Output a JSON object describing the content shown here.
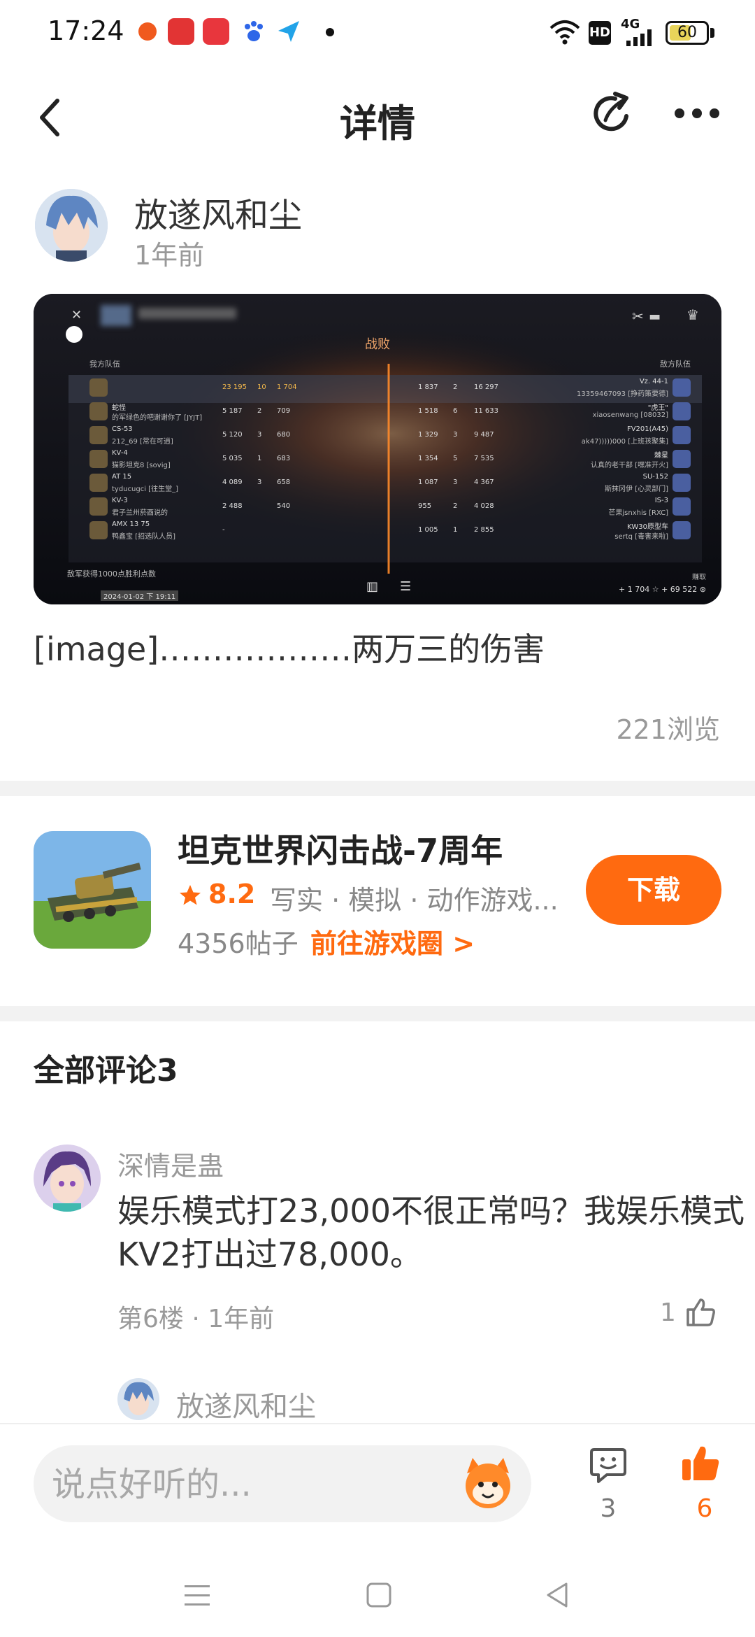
{
  "status_bar": {
    "time": "17:24",
    "network": "4G",
    "battery": "60",
    "battery_level_percent": 60
  },
  "header": {
    "title": "详情"
  },
  "post": {
    "author": "放遂风和尘",
    "time": "1年前",
    "text": "[image]………………两万三的伤害",
    "views": "221浏览"
  },
  "screenshot_overlay": {
    "center_title": "战败",
    "left_team_label": "我方队伍",
    "right_team_label": "敌方队伍",
    "left_rows": [
      {
        "name": "",
        "sub": "",
        "dmg": "23 195",
        "kills": "10",
        "xp": "1 704"
      },
      {
        "name": "蛇怪",
        "sub": "的军绿色的吧谢谢你了 [JYJT]",
        "dmg": "5 187",
        "kills": "2",
        "xp": "709"
      },
      {
        "name": "CS-53",
        "sub": "212_69 [常在可逍]",
        "dmg": "5 120",
        "kills": "3",
        "xp": "680"
      },
      {
        "name": "KV-4",
        "sub": "猫影坦克8 [sovig]",
        "dmg": "5 035",
        "kills": "1",
        "xp": "683"
      },
      {
        "name": "AT 15",
        "sub": "tyducugci [往生堂_]",
        "dmg": "4 089",
        "kills": "3",
        "xp": "658"
      },
      {
        "name": "KV-3",
        "sub": "君子兰州菸酉说的",
        "dmg": "2 488",
        "kills": "",
        "xp": "540"
      },
      {
        "name": "AMX 13 75",
        "sub": "鸭鑫宝 [招选队人员]",
        "dmg": "-",
        "kills": "",
        "xp": ""
      }
    ],
    "right_rows": [
      {
        "name": "Vz. 44-1",
        "sub": "13359467093 [挣药策要德]",
        "xp": "1 837",
        "kills": "2",
        "dmg": "16 297"
      },
      {
        "name": "\"虎王\"",
        "sub": "xiaosenwang [08032]",
        "xp": "1 518",
        "kills": "6",
        "dmg": "11 633"
      },
      {
        "name": "FV201(A45)",
        "sub": "ak47)))))000 [上班孩聚集]",
        "xp": "1 329",
        "kills": "3",
        "dmg": "9 487"
      },
      {
        "name": "棘星",
        "sub": "认真的老干部 [嘿准开火]",
        "xp": "1 354",
        "kills": "5",
        "dmg": "7 535"
      },
      {
        "name": "SU-152",
        "sub": "斯抹冈伊 [心灵部门]",
        "xp": "1 087",
        "kills": "3",
        "dmg": "4 367"
      },
      {
        "name": "IS-3",
        "sub": "芒果jsnxhis [RXC]",
        "xp": "955",
        "kills": "2",
        "dmg": "4 028"
      },
      {
        "name": "KW30原型车",
        "sub": "sertq [毒害来啦]",
        "xp": "1 005",
        "kills": "1",
        "dmg": "2 855"
      }
    ],
    "footer_left": "敌军获得1000点胜利点数",
    "footer_date": "2024-01-02 下 19:11",
    "footer_right_label": "赚取",
    "footer_right_values": "+ 1 704 ☆  + 69 522 ⊛"
  },
  "game_card": {
    "title": "坦克世界闪击战-7周年",
    "rating": "8.2",
    "tags": "写实 · 模拟 · 动作游戏...",
    "posts": "4356帖子",
    "goto": "前往游戏圈 >",
    "download": "下载"
  },
  "comments": {
    "title": "全部评论3",
    "items": [
      {
        "name": "深情是蛊",
        "text": "娱乐模式打23,000不很正常吗？我娱乐模式KV2打出过78,000。",
        "meta": "第6楼 · 1年前",
        "likes": "1"
      }
    ],
    "reply_preview_name": "放遂风和尘"
  },
  "bottom_bar": {
    "input_placeholder": "说点好听的...",
    "comment_count": "3",
    "like_count": "6"
  },
  "colors": {
    "accent": "#ff6a10",
    "muted": "#999999"
  }
}
